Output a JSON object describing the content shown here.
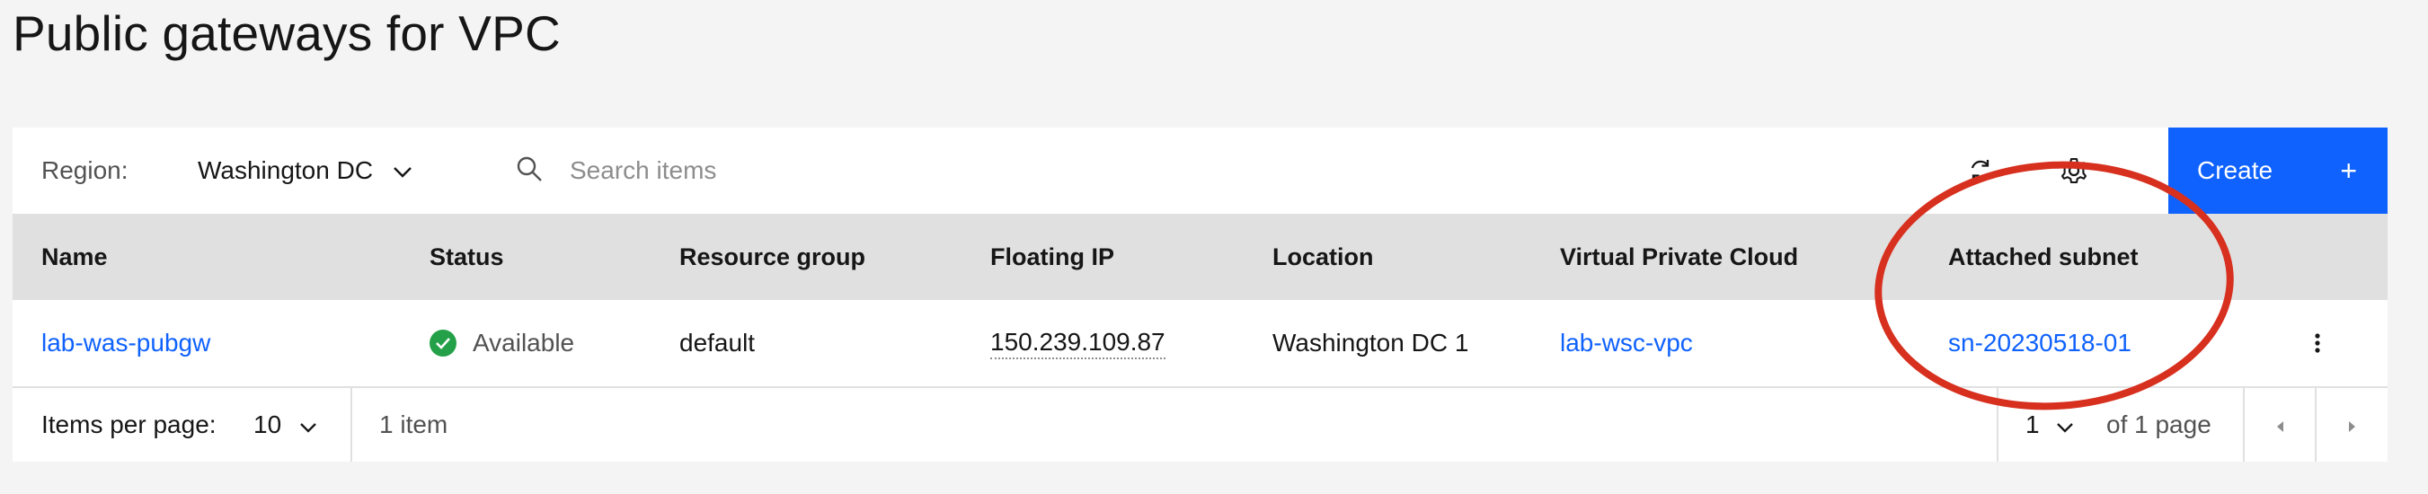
{
  "page": {
    "title": "Public gateways for VPC"
  },
  "toolbar": {
    "region_label": "Region:",
    "region_value": "Washington DC",
    "search_placeholder": "Search items",
    "create_label": "Create",
    "create_plus": "+"
  },
  "table": {
    "columns": [
      "Name",
      "Status",
      "Resource group",
      "Floating IP",
      "Location",
      "Virtual Private Cloud",
      "Attached subnet"
    ],
    "rows": [
      {
        "name": "lab-was-pubgw",
        "status": "Available",
        "resource_group": "default",
        "floating_ip": "150.239.109.87",
        "location": "Washington DC 1",
        "vpc": "lab-wsc-vpc",
        "subnet": "sn-20230518-01"
      }
    ]
  },
  "pagination": {
    "items_per_page_label": "Items per page:",
    "items_per_page_value": "10",
    "item_count": "1 item",
    "page_value": "1",
    "page_total": "of 1 page"
  },
  "colors": {
    "accent": "#0f62fe",
    "status_available": "#24a148",
    "annotation": "#d7301f"
  },
  "icons": [
    "chevron-down-icon",
    "search-icon",
    "refresh-icon",
    "gear-icon",
    "check-circle-icon",
    "overflow-menu-icon",
    "caret-left-icon",
    "caret-right-icon"
  ]
}
